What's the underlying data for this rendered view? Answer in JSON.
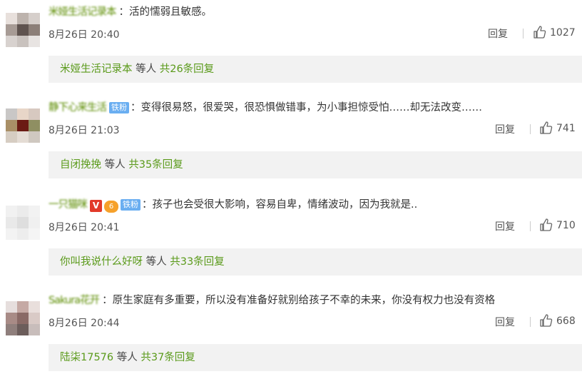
{
  "comments": [
    {
      "username": "米娅生活记录本",
      "text": "：活的懦弱且敏感。",
      "badges": [],
      "time": "8月26日 20:40",
      "reply_label": "回复",
      "likes": "1027",
      "reply_box": {
        "first_replier": "米娅生活记录本",
        "middle": " 等人 ",
        "count_text": "共26条回复"
      },
      "avatar_colors": [
        "#e8e0dc",
        "#bdb3ad",
        "#d6cfcb",
        "#a79b95",
        "#5f534f",
        "#8c7f78",
        "#d8d2cf",
        "#c9c2be",
        "#e8e4e2"
      ]
    },
    {
      "username": "静下心来生活",
      "text": "：变得很易怒，很爱哭，很恐惧做错事，为小事担惊受怕……却无法改变……",
      "badges": [
        "fan"
      ],
      "fan_label": "铁粉",
      "time": "8月26日 21:03",
      "reply_label": "回复",
      "likes": "741",
      "reply_box": {
        "first_replier": "自闭挽挽",
        "middle": " 等人 ",
        "count_text": "共35条回复"
      },
      "avatar_colors": [
        "#c9c7c6",
        "#e8d6c8",
        "#d7c9c0",
        "#a98f66",
        "#6b1b14",
        "#8f8f62",
        "#d6cdc2",
        "#e4dcd4",
        "#cfc8c0"
      ]
    },
    {
      "username": "一只猫咪",
      "text": "：孩子也会受很大影响，容易自卑，情绪波动，因为我就是..",
      "badges": [
        "v",
        "medal",
        "fan"
      ],
      "fan_label": "铁粉",
      "v_label": "V",
      "medal_label": "6",
      "time": "8月26日 20:41",
      "reply_label": "回复",
      "likes": "710",
      "reply_box": {
        "first_replier": "你叫我说什么好呀",
        "middle": " 等人 ",
        "count_text": "共33条回复"
      },
      "avatar_colors": [
        "#f1f1f1",
        "#ebebeb",
        "#f2f2f2",
        "#e9e9e9",
        "#dedede",
        "#f0f0f0",
        "#f3f3f3",
        "#ededed",
        "#f5f5f5"
      ]
    },
    {
      "username": "Sakura花开",
      "text": "：原生家庭有多重要，所以没有准备好就别给孩子不幸的未来，你没有权力也没有资格",
      "badges": [],
      "time": "8月26日 20:44",
      "reply_label": "回复",
      "likes": "668",
      "reply_box": {
        "first_replier": "陆柒17576",
        "middle": " 等人 ",
        "count_text": "共37条回复"
      },
      "avatar_colors": [
        "#e6dedd",
        "#c5a9a4",
        "#e9dfdc",
        "#a88b86",
        "#8a6a66",
        "#d9cac6",
        "#8f7f7c",
        "#6c5d5b",
        "#c8bdbb"
      ]
    }
  ]
}
